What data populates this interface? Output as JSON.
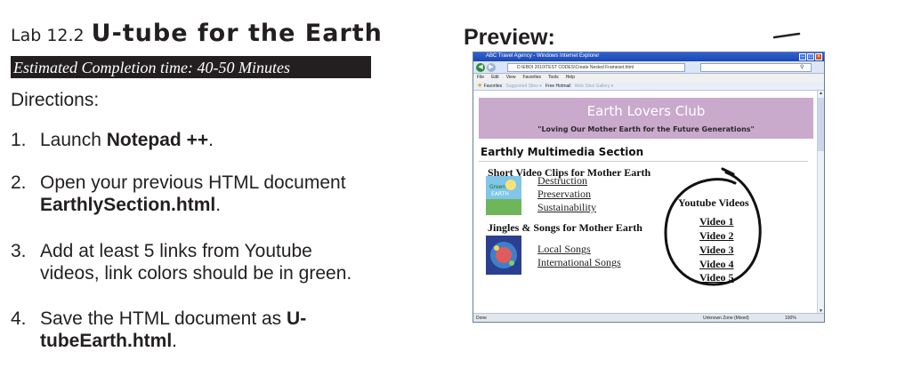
{
  "lab": {
    "number": "Lab 12.2",
    "title": "U-tube for the Earth",
    "completion_time": "Estimated Completion time:  40-50 Minutes",
    "directions_label": "Directions:"
  },
  "steps": [
    {
      "num": "1.",
      "parts": [
        "Launch ",
        "Notepad ++",
        "."
      ]
    },
    {
      "num": "2.",
      "line1": "Open your previous HTML document",
      "line2_bold": "EarthlySection.html",
      "line2_tail": "."
    },
    {
      "num": "3.",
      "line1": "Add at least 5 links from Youtube",
      "line2": "videos, link colors should be in green."
    },
    {
      "num": "4.",
      "line1_plain": "Save the HTML document as ",
      "line1_bold": "U-",
      "line2_bold": "tubeEarth.html",
      "line2_tail": "."
    }
  ],
  "preview": {
    "heading": "Preview:",
    "browser": {
      "window_title": "ABC Travel Agency - Windows Internet Explorer",
      "address": "D:\\EBOI 2010\\TEST CODES\\Create Nested Frameset.html",
      "menu": [
        "File",
        "Edit",
        "View",
        "Favorites",
        "Tools",
        "Help"
      ],
      "favorites_label": "Favorites",
      "favorites_items": [
        "Suggested Sites ▾",
        "Free Hotmail",
        "Web Slice Gallery ▾"
      ],
      "status_left": "Done",
      "status_zone": "Unknown Zone (Mixed)",
      "status_zoom": "100%"
    },
    "page": {
      "banner_title": "Earth Lovers Club",
      "banner_subtitle": "\"Loving Our Mother Earth for the Future Generations\"",
      "section_heading": "Earthly Multimedia Section",
      "clips_heading": "Short Video Clips for Mother Earth",
      "clip_links": [
        "Destruction",
        "Preservation",
        "Sustainability"
      ],
      "jingles_heading": "Jingles & Songs for Mother Earth",
      "song_links": [
        "Local Songs",
        "International Songs"
      ],
      "youtube_heading": "Youtube Videos",
      "video_links": [
        "Video 1",
        "Video 2",
        "Video 3",
        "Video 4",
        "Video 5"
      ]
    }
  },
  "colors": {
    "text": "#231f20",
    "banner": "#c9a9cc",
    "titlebar": "#1d46b3"
  }
}
